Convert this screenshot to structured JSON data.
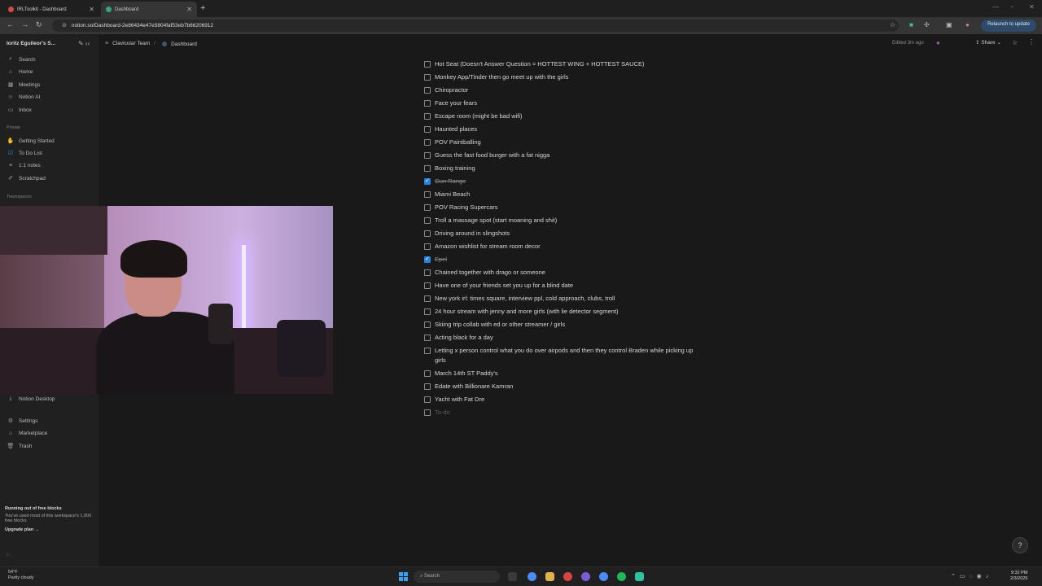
{
  "browser": {
    "tabs": [
      {
        "label": "IRLToolkit - Dashboard",
        "fav_color": "#d34a4a"
      },
      {
        "label": "Dashboard",
        "fav_color": "#3aa37a"
      }
    ],
    "url": "notion.so/Dashboard-2e86434e47e5804faf53eb7b66206912",
    "relaunch_label": "Relaunch to update"
  },
  "sidebar": {
    "workspace": "Ioritz Eguileor's S...",
    "top_items": [
      {
        "label": "Search",
        "icon": "search-icon"
      },
      {
        "label": "Home",
        "icon": "home-icon"
      },
      {
        "label": "Meetings",
        "icon": "meetings-icon"
      },
      {
        "label": "Notion AI",
        "icon": "ai-icon"
      },
      {
        "label": "Inbox",
        "icon": "inbox-icon"
      }
    ],
    "private_heading": "Private",
    "private_items": [
      {
        "label": "Getting Started",
        "icon": "wave-icon"
      },
      {
        "label": "To Do List",
        "icon": "checklist-icon"
      },
      {
        "label": "1:1 notes",
        "icon": "notes-icon"
      },
      {
        "label": "Scratchpad",
        "icon": "pen-icon"
      }
    ],
    "teamspaces_heading": "Teamspaces",
    "bottom_items": [
      {
        "label": "Notion Desktop",
        "icon": "download-icon"
      },
      {
        "label": "Settings",
        "icon": "gear-icon"
      },
      {
        "label": "Marketplace",
        "icon": "marketplace-icon"
      },
      {
        "label": "Trash",
        "icon": "trash-icon"
      }
    ],
    "upgrade": {
      "title": "Running out of free blocks",
      "body": "You've used most of this workspace's 1,000 free blocks",
      "cta": "Upgrade plan"
    }
  },
  "header": {
    "breadcrumbs": [
      "Clavicular Team",
      "Dashboard"
    ],
    "edited": "Edited 3m ago",
    "share": "Share"
  },
  "checklist": {
    "items": [
      {
        "label": "Hot Seat (Doesn't Answer Question = HOTTEST WING + HOTTEST SAUCE)",
        "checked": false
      },
      {
        "label": "Monkey App/Tinder then go meet up with the girls",
        "checked": false
      },
      {
        "label": "Chiropractor",
        "checked": false
      },
      {
        "label": "Face your fears",
        "checked": false
      },
      {
        "label": "Escape room (might be bad wifi)",
        "checked": false
      },
      {
        "label": "Haunted places",
        "checked": false
      },
      {
        "label": "POV Paintballing",
        "checked": false
      },
      {
        "label": "Guess the fast food burger with a fat nigga",
        "checked": false
      },
      {
        "label": "Boxing training",
        "checked": false
      },
      {
        "label": "Gun Range",
        "checked": true
      },
      {
        "label": "Miami Beach",
        "checked": false
      },
      {
        "label": "POV Racing Supercars",
        "checked": false
      },
      {
        "label": "Troll a massage spot (start moaning and shit)",
        "checked": false
      },
      {
        "label": "Driving around in slingshots",
        "checked": false
      },
      {
        "label": "Amazon wishlist for stream room decor",
        "checked": false
      },
      {
        "label": "Epel",
        "checked": true
      },
      {
        "label": "Chained together with drago or someone",
        "checked": false
      },
      {
        "label": "Have one of your friends set you up for a blind date",
        "checked": false
      },
      {
        "label": "New york irl: times square, interview ppl, cold approach, clubs, troll",
        "checked": false
      },
      {
        "label": "24 hour stream with jenny and more girls (with lie detector segment)",
        "checked": false
      },
      {
        "label": "Skiing trip collab with ed or other streamer / girls",
        "checked": false
      },
      {
        "label": "Acting black for a day",
        "checked": false
      },
      {
        "label": "Letting x person control what you do over airpods and then they control Braden while picking up girls",
        "checked": false
      },
      {
        "label": "March 14th ST Paddy's",
        "checked": false
      },
      {
        "label": "Edate with Billionare Kamran",
        "checked": false
      },
      {
        "label": "Yacht with Fat Dre",
        "checked": false
      }
    ],
    "placeholder": "To-do"
  },
  "taskbar": {
    "weather_temp": "54°F",
    "weather_desc": "Partly cloudy",
    "search_placeholder": "Search",
    "time": "9:32 PM",
    "date": "2/3/2026"
  }
}
